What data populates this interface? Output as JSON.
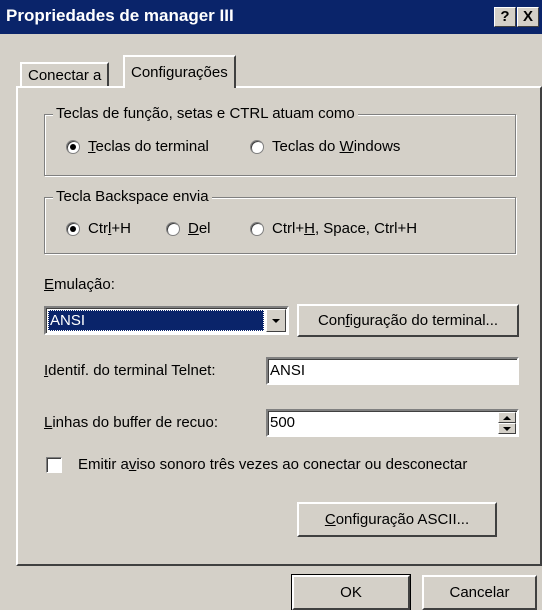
{
  "window": {
    "title": "Propriedades de manager III",
    "help_glyph": "?",
    "close_glyph": "X"
  },
  "tabs": [
    {
      "label": "Conectar a",
      "active": false
    },
    {
      "label": "Configurações",
      "active": true
    }
  ],
  "function_keys_group": {
    "legend": "Teclas de função, setas e CTRL atuam como",
    "options": [
      {
        "pre": "",
        "ul": "T",
        "post": "eclas do terminal",
        "selected": true
      },
      {
        "pre": "Teclas do ",
        "ul": "W",
        "post": "indows",
        "selected": false
      }
    ]
  },
  "backspace_group": {
    "legend": "Tecla Backspace envia",
    "options": [
      {
        "pre": "Ctr",
        "ul": "l",
        "post": "+H",
        "selected": true
      },
      {
        "pre": "",
        "ul": "D",
        "post": "el",
        "selected": false
      },
      {
        "pre": "Ctrl+",
        "ul": "H",
        "post": ", Space, Ctrl+H",
        "selected": false
      }
    ]
  },
  "emulation": {
    "label_ul": "E",
    "label_rest": "mulação:",
    "value": "ANSI",
    "terminal_btn_pre": "Con",
    "terminal_btn_ul": "f",
    "terminal_btn_post": "iguração do terminal..."
  },
  "telnet": {
    "label_ul": "I",
    "label_rest": "dentif. do terminal Telnet:",
    "value": "ANSI"
  },
  "buffer": {
    "label_ul": "L",
    "label_rest": "inhas do buffer de recuo:",
    "value": "500"
  },
  "beep": {
    "pre": "Emitir a",
    "ul": "v",
    "post": "iso sonoro três vezes ao conectar ou desconectar",
    "checked": false
  },
  "ascii_btn": {
    "ul": "C",
    "rest": "onfiguração ASCII..."
  },
  "footer": {
    "ok": "OK",
    "cancel": "Cancelar"
  },
  "colors": {
    "face": "#d4d0c8",
    "titlebar": "#0a246a",
    "selection": "#0a246a"
  }
}
